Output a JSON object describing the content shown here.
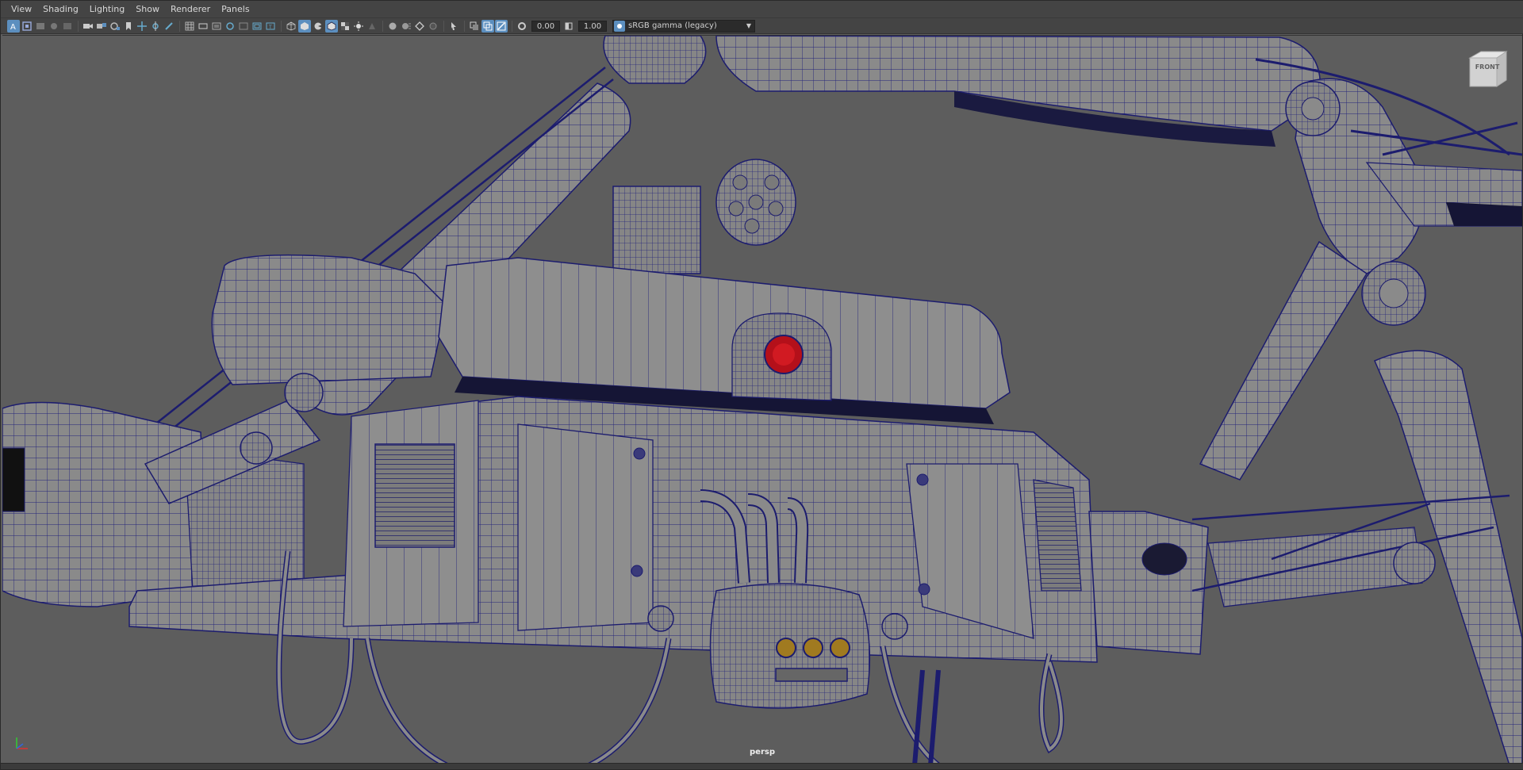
{
  "menu": {
    "view": "View",
    "shading": "Shading",
    "lighting": "Lighting",
    "show": "Show",
    "renderer": "Renderer",
    "panels": "Panels"
  },
  "toolbar": {
    "exposure_value": "0.00",
    "gamma_value": "1.00",
    "color_space": "sRGB gamma (legacy)",
    "icons": [
      "select-camera-icon",
      "camera-attributes-icon",
      "bookmark-icon",
      "image-plane-icon",
      "grid-icon",
      "film-gate-icon",
      "resolution-gate-icon",
      "gate-mask-icon",
      "field-chart-icon",
      "safe-action-icon",
      "safe-title-icon",
      "wireframe-icon",
      "smooth-shade-icon",
      "default-material-icon",
      "textured-icon",
      "use-all-lights-icon",
      "shadows-icon",
      "screen-space-ao-icon",
      "motion-blur-icon",
      "multisample-aa-icon",
      "depth-of-field-icon",
      "isolate-select-icon",
      "xray-icon",
      "xray-joints-icon",
      "backface-culling-icon",
      "exposure-icon",
      "gamma-icon"
    ],
    "accent_color": "#5c8fbf"
  },
  "viewport": {
    "camera_name": "persp",
    "view_cube_label": "FRONT",
    "background_color": "#5d5d5d",
    "wire_color": "#1c1c6e"
  }
}
